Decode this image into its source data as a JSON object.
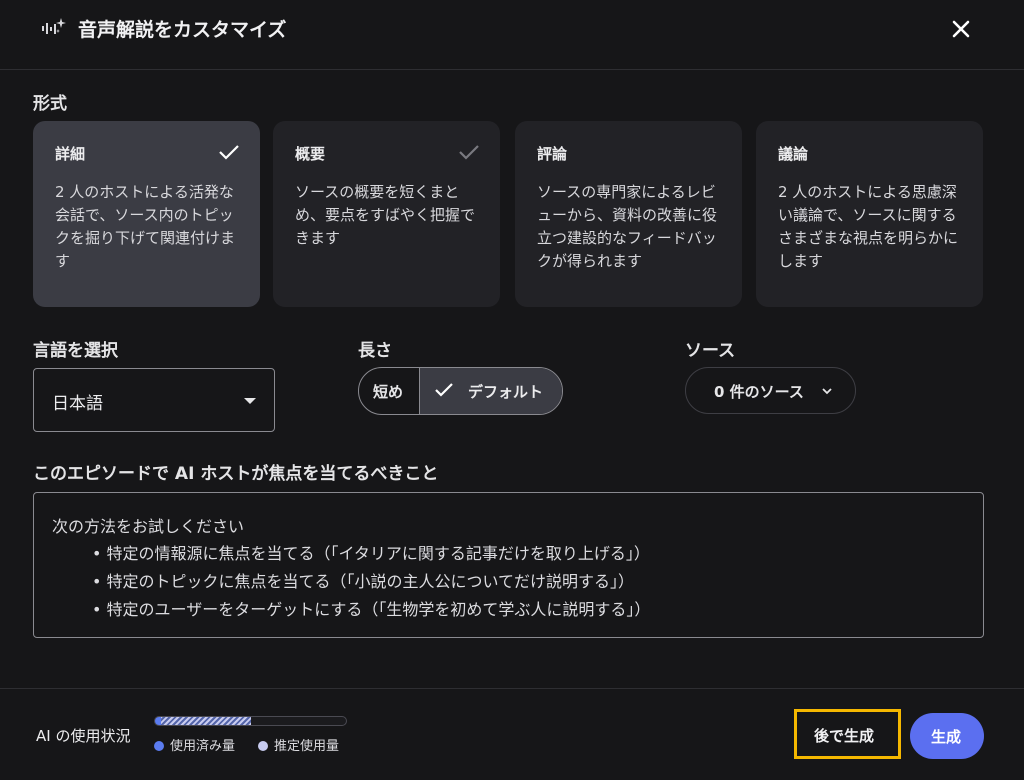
{
  "header": {
    "title": "音声解説をカスタマイズ",
    "icon": "sparkle-waveform-icon",
    "close_icon": "close-icon"
  },
  "format": {
    "label": "形式",
    "options": [
      {
        "title": "詳細",
        "description": "2 人のホストによる活発な会話で、ソース内のトピックを掘り下げて関連付けます",
        "selected": true
      },
      {
        "title": "概要",
        "description": "ソースの概要を短くまとめ、要点をすばやく把握できます",
        "selected": false
      },
      {
        "title": "評論",
        "description": "ソースの専門家によるレビューから、資料の改善に役立つ建設的なフィードバックが得られます",
        "selected": false
      },
      {
        "title": "議論",
        "description": "2 人のホストによる思慮深い議論で、ソースに関するさまざまな視点を明らかにします",
        "selected": false
      }
    ]
  },
  "language": {
    "label": "言語を選択",
    "value": "日本語"
  },
  "length": {
    "label": "長さ",
    "options": [
      "短め",
      "デフォルト"
    ],
    "selected": "デフォルト"
  },
  "source": {
    "label": "ソース",
    "button_label": "0 件のソース"
  },
  "focus": {
    "label": "このエピソードで AI ホストが焦点を当てるべきこと",
    "placeholder_title": "次の方法をお試しください",
    "examples": [
      "特定の情報源に焦点を当てる（「イタリアに関する記事だけを取り上げる」）",
      "特定のトピックに焦点を当てる（「小説の主人公についてだけ説明する」）",
      "特定のユーザーをターゲットにする（「生物学を初めて学ぶ人に説明する」）"
    ]
  },
  "usage": {
    "label": "AI の使用状況",
    "used_fraction": 0.03,
    "estimated_fraction": 0.5,
    "legend_used": "使用済み量",
    "legend_estimated": "推定使用量",
    "colors": {
      "used": "#5b7cf0",
      "estimated": "#c8ccf0"
    }
  },
  "actions": {
    "later_label": "後で生成",
    "generate_label": "生成"
  }
}
